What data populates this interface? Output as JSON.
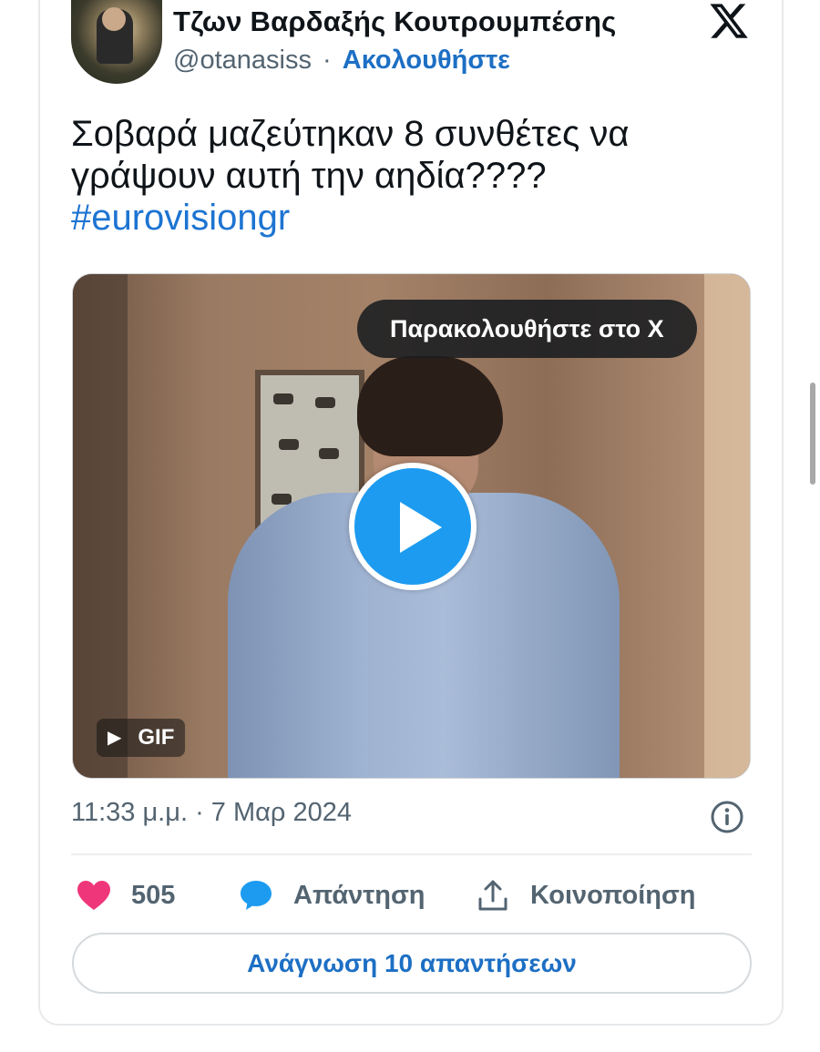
{
  "author": {
    "name": "Τζων Βαρδαξής Κουτρουμπέσης",
    "handle": "@otanasiss",
    "separator": "·",
    "follow_label": "Ακολουθήστε"
  },
  "tweet": {
    "text": "Σοβαρά μαζεύτηκαν 8 συνθέτες να γράψουν αυτή την αηδία????",
    "hashtag": "#eurovisiongr",
    "timestamp": "11:33 μ.μ. · 7 Μαρ 2024"
  },
  "media": {
    "watch_label": "Παρακολουθήστε στο X",
    "badge": "GIF"
  },
  "actions": {
    "likes": "505",
    "reply_label": "Απάντηση",
    "share_label": "Κοινοποίηση"
  },
  "read_replies_label": "Ανάγνωση 10 απαντήσεων",
  "colors": {
    "accent_blue": "#1d9bf0",
    "link_blue": "#1d6fc4",
    "like_pink": "#f0367a",
    "muted_gray": "#536471"
  },
  "icons": [
    "x-logo-icon",
    "play-icon",
    "info-icon",
    "heart-icon",
    "reply-bubble-icon",
    "share-icon"
  ]
}
